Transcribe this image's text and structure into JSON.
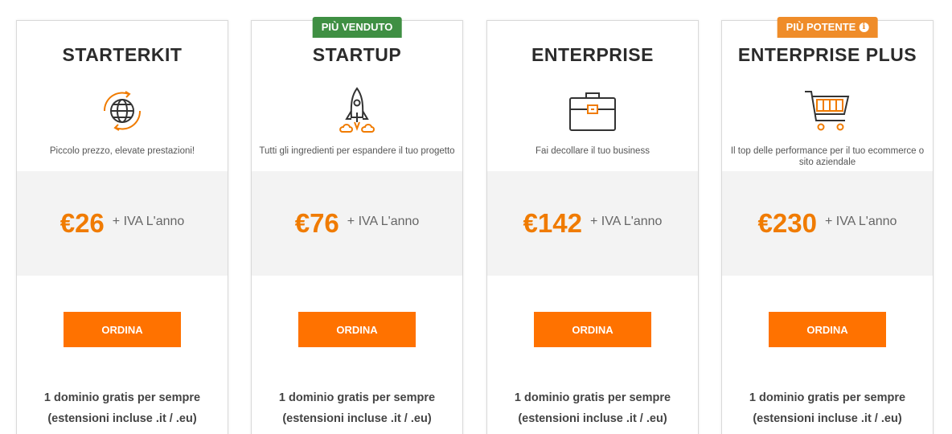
{
  "plans": [
    {
      "name": "STARTERKIT",
      "icon": "globe-icon",
      "description": "Piccolo prezzo, elevate prestazioni!",
      "price": "€26",
      "price_suffix": "+ IVA L'anno",
      "button": "ORDINA",
      "feature_line1": "1 dominio gratis per sempre",
      "feature_line2": "(estensioni incluse .it / .eu)"
    },
    {
      "name": "STARTUP",
      "badge": "PIÙ VENDUTO",
      "icon": "rocket-icon",
      "description": "Tutti gli ingredienti per espandere il tuo progetto",
      "price": "€76",
      "price_suffix": "+ IVA L'anno",
      "button": "ORDINA",
      "feature_line1": "1 dominio gratis per sempre",
      "feature_line2": "(estensioni incluse .it / .eu)"
    },
    {
      "name": "ENTERPRISE",
      "icon": "briefcase-icon",
      "description": "Fai decollare il tuo business",
      "price": "€142",
      "price_suffix": "+ IVA L'anno",
      "button": "ORDINA",
      "feature_line1": "1 dominio gratis per sempre",
      "feature_line2": "(estensioni incluse .it / .eu)"
    },
    {
      "name": "ENTERPRISE PLUS",
      "badge": "PIÙ POTENTE",
      "icon": "shopping-cart-icon",
      "description": "Il top delle performance per il tuo ecommerce o sito aziendale",
      "price": "€230",
      "price_suffix": "+ IVA L'anno",
      "button": "ORDINA",
      "feature_line1": "1 dominio gratis per sempre",
      "feature_line2": "(estensioni incluse .it / .eu)"
    }
  ],
  "colors": {
    "accent": "#ff7200",
    "price": "#f07b00",
    "badge_green": "#3f8f43",
    "badge_orange": "#ef8c29",
    "price_box": "#f3f3f3"
  }
}
